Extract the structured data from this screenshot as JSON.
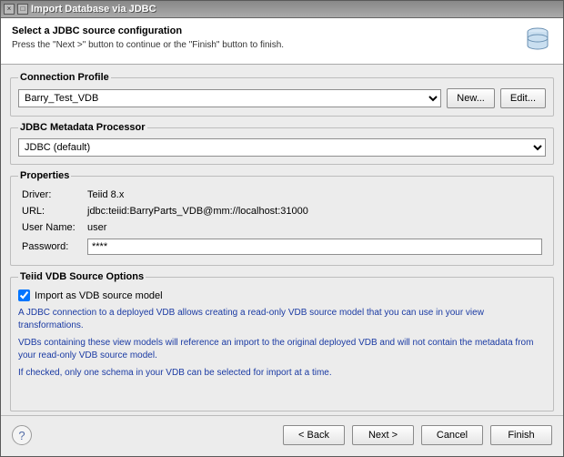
{
  "title": "Import Database via JDBC",
  "banner": {
    "heading": "Select a JDBC source configuration",
    "sub": "Press the \"Next >\" button to continue or the \"Finish\" button to finish."
  },
  "connectionProfile": {
    "legend": "Connection Profile",
    "selected": "Barry_Test_VDB",
    "new_label": "New...",
    "edit_label": "Edit..."
  },
  "metadataProcessor": {
    "legend": "JDBC Metadata Processor",
    "selected": "JDBC (default)"
  },
  "properties": {
    "legend": "Properties",
    "driver_label": "Driver:",
    "driver_value": "Teiid 8.x",
    "url_label": "URL:",
    "url_value": "jdbc:teiid:BarryParts_VDB@mm://localhost:31000",
    "username_label": "User Name:",
    "username_value": "user",
    "password_label": "Password:",
    "password_mask": "****"
  },
  "vdbOptions": {
    "legend": "Teiid VDB Source Options",
    "checkbox_label": "Import as VDB source model",
    "para1": "A JDBC connection to a deployed VDB allows creating a read-only VDB source model that you can use in your view transformations.",
    "para2": "VDBs containing these view models will reference an import to the original deployed VDB and will not contain the metadata from your read-only VDB source model.",
    "para3": "If checked, only one schema in your VDB can be selected for import at a time."
  },
  "footer": {
    "back": "< Back",
    "next": "Next >",
    "cancel": "Cancel",
    "finish": "Finish"
  }
}
